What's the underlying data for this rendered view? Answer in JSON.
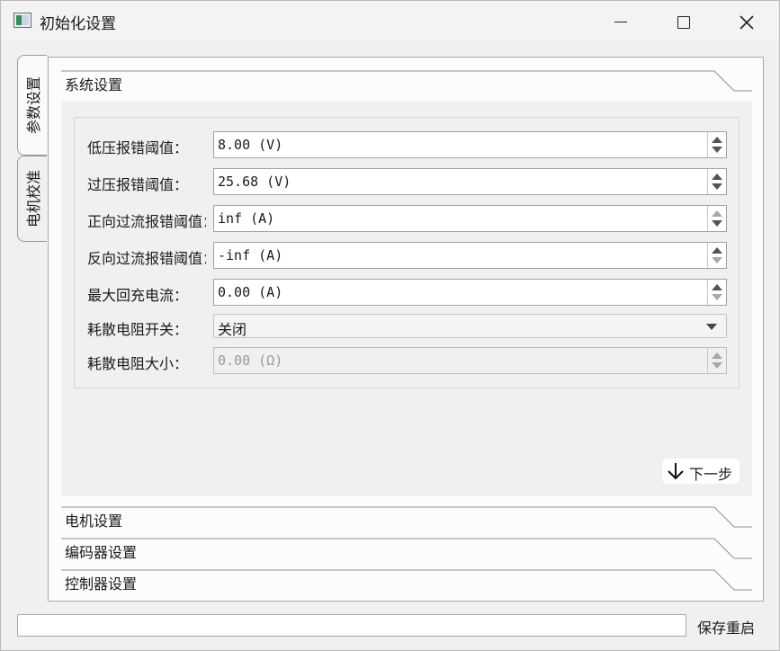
{
  "window": {
    "title": "初始化设置",
    "controls": {
      "minimize_icon": "minimize-icon",
      "maximize_icon": "maximize-icon",
      "close_icon": "close-icon"
    }
  },
  "vertical_tabs": [
    {
      "label": "参数设置",
      "active": true
    },
    {
      "label": "电机校准",
      "active": false
    }
  ],
  "sections": {
    "system": {
      "label": "系统设置",
      "expanded": true
    },
    "motor": {
      "label": "电机设置"
    },
    "encoder": {
      "label": "编码器设置"
    },
    "controller": {
      "label": "控制器设置"
    }
  },
  "system_settings": {
    "fields": [
      {
        "label": "低压报错阈值：",
        "value": "8.00 (V)",
        "type": "spin",
        "up_enabled": true,
        "down_enabled": true,
        "enabled": true
      },
      {
        "label": "过压报错阈值：",
        "value": "25.68 (V)",
        "type": "spin",
        "up_enabled": true,
        "down_enabled": true,
        "enabled": true
      },
      {
        "label": "正向过流报错阈值：",
        "value": "inf (A)",
        "type": "spin",
        "up_enabled": false,
        "down_enabled": true,
        "enabled": true
      },
      {
        "label": "反向过流报错阈值：",
        "value": "-inf (A)",
        "type": "spin",
        "up_enabled": true,
        "down_enabled": false,
        "enabled": true
      },
      {
        "label": "最大回充电流：",
        "value": "0.00 (A)",
        "type": "spin",
        "up_enabled": true,
        "down_enabled": false,
        "enabled": true
      },
      {
        "label": "耗散电阻开关：",
        "value": "关闭",
        "type": "combo",
        "enabled": true
      },
      {
        "label": "耗散电阻大小：",
        "value": "0.00 (Ω)",
        "type": "spin",
        "enabled": false
      }
    ],
    "next_button": {
      "label": "下一步",
      "icon": "arrow-down-icon"
    }
  },
  "footer": {
    "status_value": "",
    "save_button_label": "保存重启"
  }
}
